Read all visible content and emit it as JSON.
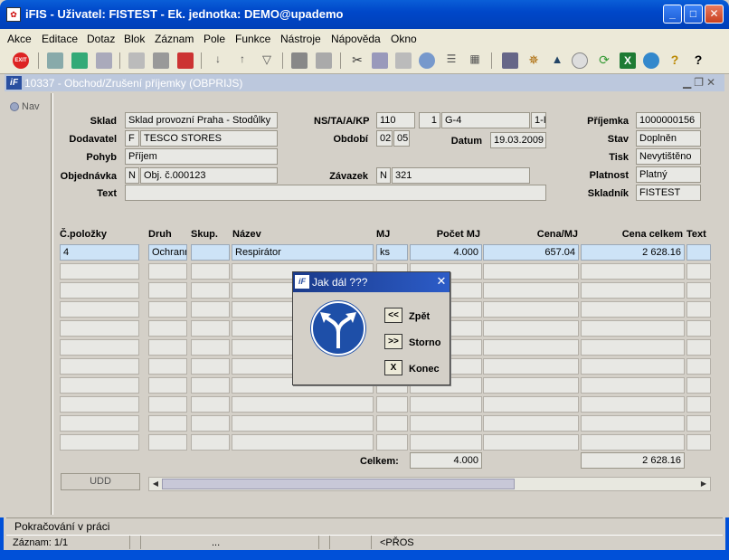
{
  "window": {
    "title": "iFIS - Uživatel: FISTEST - Ek. jednotka: DEMO@upademo",
    "app_icon": "ifis-app-icon",
    "controls": [
      "minimize",
      "maximize",
      "close"
    ]
  },
  "menu": {
    "items": [
      "Akce",
      "Editace",
      "Dotaz",
      "Blok",
      "Záznam",
      "Pole",
      "Funkce",
      "Nástroje",
      "Nápověda",
      "Okno"
    ]
  },
  "toolbar": {
    "icons": [
      "exit-icon",
      "insert-record-icon",
      "save-icon",
      "delete-record-icon",
      "query-icon",
      "execute-query-icon",
      "cancel-query-icon",
      "sort-asc-icon",
      "sort-desc-icon",
      "filter-icon",
      "print-icon",
      "print-preview-icon",
      "cut-icon",
      "copy-icon",
      "paste-icon",
      "find-icon",
      "list-icon",
      "grid-icon",
      "calculator-icon",
      "settings-wheel-icon",
      "chart-icon",
      "clock-icon",
      "refresh-icon",
      "excel-icon",
      "internet-icon",
      "help-question-icon",
      "context-help-icon"
    ]
  },
  "child_window": {
    "icon_text": "iF",
    "title": "10337 - Obchod/Zrušení příjemky (OBPRIJS)"
  },
  "nav": {
    "label": "Nav"
  },
  "header": {
    "sklad": {
      "label": "Sklad",
      "value": "Sklad provozní Praha - Stodůlky"
    },
    "dodavatel": {
      "label": "Dodavatel",
      "flag": "F",
      "value": "TESCO STORES"
    },
    "pohyb": {
      "label": "Pohyb",
      "value": "Příjem"
    },
    "objednavka": {
      "label": "Objednávka",
      "flag": "N",
      "value": "Obj. č.000123"
    },
    "text": {
      "label": "Text",
      "value": ""
    },
    "ns": {
      "label": "NS/TA/A/KP",
      "v1": "110",
      "v2": "1",
      "v3": "G-4",
      "v4": "1-I"
    },
    "obdobi": {
      "label": "Období",
      "v1": "02",
      "v2": "05"
    },
    "datum": {
      "label": "Datum",
      "value": "19.03.2009"
    },
    "zavazek": {
      "label": "Závazek",
      "flag": "N",
      "value": "321"
    },
    "prijemka": {
      "label": "Příjemka",
      "value": "1000000156"
    },
    "stav": {
      "label": "Stav",
      "value": "Doplněn"
    },
    "tisk": {
      "label": "Tisk",
      "value": "Nevytištěno"
    },
    "platnost": {
      "label": "Platnost",
      "value": "Platný"
    },
    "skladnik": {
      "label": "Skladník",
      "value": "FISTEST"
    }
  },
  "table": {
    "columns": [
      "Č.položky",
      "Druh",
      "Skup.",
      "Název",
      "MJ",
      "Počet MJ",
      "Cena/MJ",
      "Cena celkem",
      "Text"
    ],
    "rows": [
      {
        "polozka": "4",
        "druh": "Ochranr",
        "skup": "",
        "nazev": "Respirátor",
        "mj": "ks",
        "pocet": "4.000",
        "cena_mj": "657.04",
        "cena_celkem": "2 628.16",
        "text": ""
      }
    ],
    "total_label": "Celkem:",
    "total_pocet": "4.000",
    "total_cena": "2 628.16",
    "udd_label": "UDD"
  },
  "dialog": {
    "icon_text": "iF",
    "title": "Jak dál ???",
    "sign_icon": "direction-split-sign-icon",
    "buttons": [
      {
        "key": "<<",
        "label": "Zpět"
      },
      {
        "key": ">>",
        "label": "Storno"
      },
      {
        "key": "X",
        "label": "Konec"
      }
    ]
  },
  "status": {
    "message": "Pokračování v práci",
    "record": "Záznam: 1/1",
    "dots": "...",
    "mode": "<PŘOS"
  }
}
